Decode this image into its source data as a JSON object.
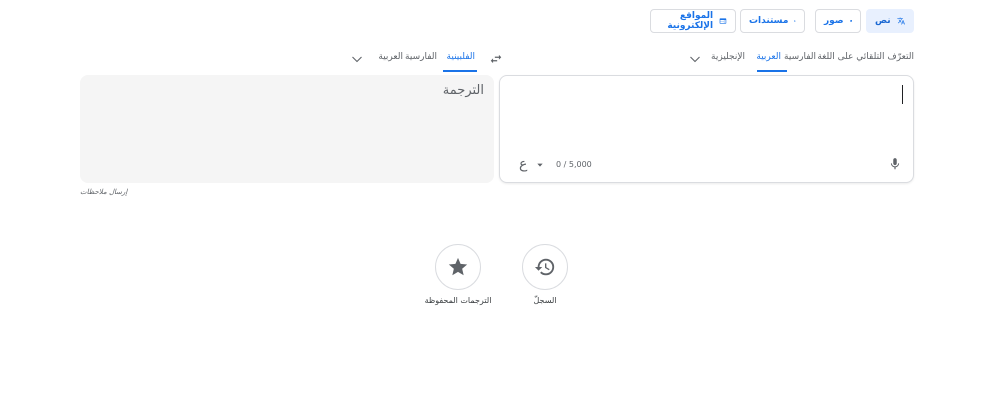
{
  "modes": {
    "text": "نص",
    "images": "صور",
    "documents": "مستندات",
    "websites": "المواقع الإلكترونية"
  },
  "source_langs": {
    "detect": "التعرّف التلقائي على اللغة",
    "persian": "الفارسية",
    "arabic": "العربية",
    "english": "الإنجليزية"
  },
  "target_langs": {
    "filipino": "الفلبينية",
    "persian": "الفارسية",
    "arabic": "العربية"
  },
  "source": {
    "char_count": "0 / 5,000",
    "input_tool": "ع"
  },
  "target": {
    "placeholder": "الترجمة"
  },
  "feedback": "إرسال ملاحظات",
  "history": "السجلّ",
  "saved": "الترجمات المحفوظة",
  "colors": {
    "accent": "#1a73e8",
    "active_bg": "#e8f0fe",
    "target_bg": "#f5f5f5"
  }
}
